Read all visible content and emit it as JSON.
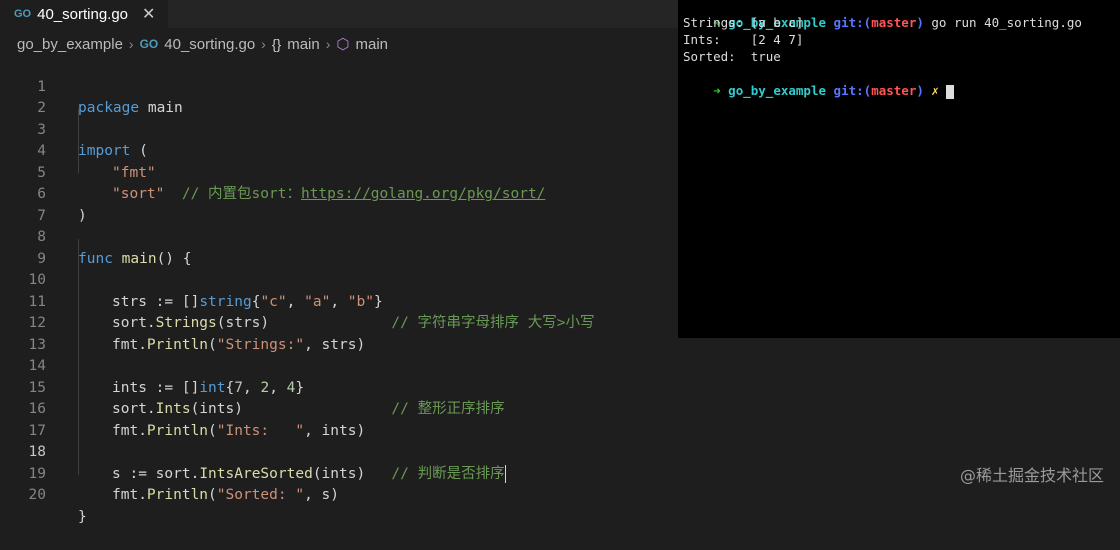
{
  "tab": {
    "icon": "go-file-icon",
    "icon_text": "GO",
    "title": "40_sorting.go",
    "close": "✕"
  },
  "breadcrumb": {
    "folder": "go_by_example",
    "file": "40_sorting.go",
    "braces": "{}",
    "func1": "main",
    "func2": "main"
  },
  "editor": {
    "active_line": 18,
    "line_numbers": [
      "1",
      "2",
      "3",
      "4",
      "5",
      "6",
      "7",
      "8",
      "9",
      "10",
      "11",
      "12",
      "13",
      "14",
      "15",
      "16",
      "17",
      "18",
      "19",
      "20"
    ],
    "l1": {
      "kw": "package",
      "rest": " main"
    },
    "l3": {
      "kw": "import",
      "rest": " ("
    },
    "l4": {
      "str": "\"fmt\""
    },
    "l5": {
      "str": "\"sort\"",
      "cmt": "  // 内置包sort：",
      "link": "https://golang.org/pkg/sort/"
    },
    "l6": {
      "text": ")"
    },
    "l8": {
      "kw": "func",
      "fn": " main",
      "rest": "() {"
    },
    "l10": {
      "a": "strs := []",
      "t": "string",
      "b": "{",
      "s1": "\"c\"",
      "c1": ", ",
      "s2": "\"a\"",
      "c2": ", ",
      "s3": "\"b\"",
      "e": "}"
    },
    "l11": {
      "pkg": "sort.",
      "fn": "Strings",
      "rest": "(strs)",
      "cmt": "              // 字符串字母排序 大写>小写"
    },
    "l12": {
      "pkg": "fmt.",
      "fn": "Println",
      "open": "(",
      "str": "\"Strings:\"",
      "rest": ", strs)"
    },
    "l14": {
      "a": "ints := []",
      "t": "int",
      "b": "{",
      "n1": "7",
      "c1": ", ",
      "n2": "2",
      "c2": ", ",
      "n3": "4",
      "e": "}"
    },
    "l15": {
      "pkg": "sort.",
      "fn": "Ints",
      "rest": "(ints)",
      "cmt": "                 // 整形正序排序"
    },
    "l16": {
      "pkg": "fmt.",
      "fn": "Println",
      "open": "(",
      "str": "\"Ints:   \"",
      "rest": ", ints)"
    },
    "l18": {
      "a": "s := sort.",
      "fn": "IntsAreSorted",
      "rest": "(ints)",
      "cmt": "   // 判断是否排序"
    },
    "l19": {
      "pkg": "fmt.",
      "fn": "Println",
      "open": "(",
      "str": "\"Sorted: \"",
      "rest": ", s)"
    },
    "l20": {
      "text": "}"
    }
  },
  "terminal": {
    "prompt_arrow": "➜",
    "dir": "go_by_example",
    "git": "git:(",
    "branch": "master",
    "git_close": ")",
    "command": " go run 40_sorting.go",
    "out1": "Strings: [a b c]",
    "out2": "Ints:    [2 4 7]",
    "out3": "Sorted:  true",
    "dirty": "✗"
  },
  "watermark": "@稀土掘金技术社区",
  "colors": {
    "editor_bg": "#1e1e1e",
    "terminal_bg": "#000000",
    "keyword": "#569cd6",
    "string": "#ce9178",
    "function": "#dcdcaa",
    "comment": "#6a9955"
  }
}
